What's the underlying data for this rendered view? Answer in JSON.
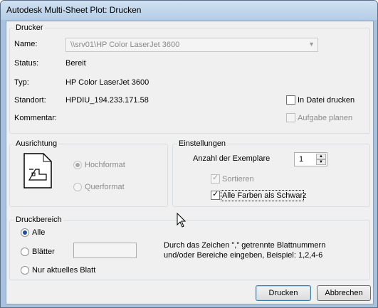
{
  "window": {
    "title": "Autodesk Multi-Sheet Plot: Drucken"
  },
  "printer": {
    "group_title": "Drucker",
    "name_label": "Name:",
    "name_value": "\\\\srv01\\HP Color LaserJet 3600",
    "status_label": "Status:",
    "status_value": "Bereit",
    "type_label": "Typ:",
    "type_value": "HP Color LaserJet 3600",
    "location_label": "Standort:",
    "location_value": "HPDIU_194.233.171.58",
    "comment_label": "Kommentar:",
    "comment_value": "",
    "print_to_file_label": "In Datei drucken",
    "print_to_file_checked": false,
    "schedule_label": "Aufgabe planen",
    "schedule_checked": false
  },
  "orientation": {
    "group_title": "Ausrichtung",
    "portrait_label": "Hochformat",
    "landscape_label": "Querformat",
    "selected": "Hochformat"
  },
  "settings": {
    "group_title": "Einstellungen",
    "copies_label": "Anzahl der Exemplare",
    "copies_value": "1",
    "collate_label": "Sortieren",
    "collate_checked": true,
    "all_black_label": "Alle Farben als Schwarz",
    "all_black_checked": true
  },
  "print_range": {
    "group_title": "Druckbereich",
    "all_label": "Alle",
    "sheets_label": "Blätter",
    "current_label": "Nur aktuelles Blatt",
    "selected": "Alle",
    "sheets_value": "",
    "hint_line1": "Durch das Zeichen \",\" getrennte Blattnummern",
    "hint_line2": "und/oder Bereiche eingeben, Beispiel: 1,2,4-6"
  },
  "buttons": {
    "print": "Drucken",
    "cancel": "Abbrechen"
  },
  "icons": {
    "check": "✓",
    "dropdown": "▼",
    "spin_up": "▲",
    "spin_down": "▼"
  },
  "colors": {
    "title_bar": "#b6cde6",
    "dialog_bg": "#f0f0f0",
    "radio_selected": "#1a4fa0",
    "default_button_border": "#3c7fb1"
  }
}
